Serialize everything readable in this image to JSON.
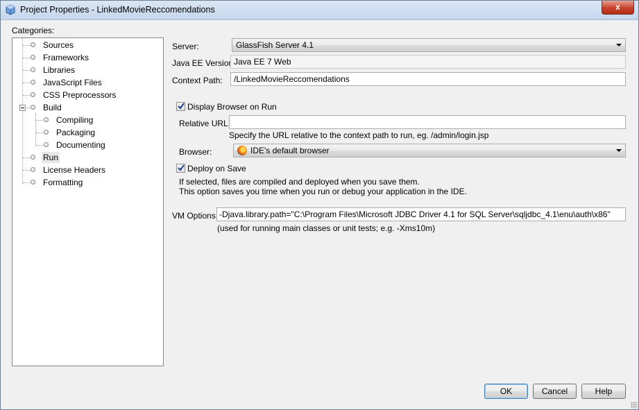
{
  "window": {
    "title": "Project Properties - LinkedMovieReccomendations",
    "close_label": "x"
  },
  "categories": {
    "label": "Categories:",
    "items": [
      {
        "label": "Sources"
      },
      {
        "label": "Frameworks"
      },
      {
        "label": "Libraries"
      },
      {
        "label": "JavaScript Files"
      },
      {
        "label": "CSS Preprocessors"
      },
      {
        "label": "Build",
        "expanded": true
      },
      {
        "label": "Compiling",
        "child_of": "Build"
      },
      {
        "label": "Packaging",
        "child_of": "Build"
      },
      {
        "label": "Documenting",
        "child_of": "Build"
      },
      {
        "label": "Run",
        "selected": true
      },
      {
        "label": "License Headers"
      },
      {
        "label": "Formatting"
      }
    ]
  },
  "run": {
    "server_label": "Server:",
    "server_value": "GlassFish Server 4.1",
    "javaee_label": "Java EE Version:",
    "javaee_value": "Java EE 7 Web",
    "context_label": "Context Path:",
    "context_value": "/LinkedMovieReccomendations",
    "display_browser_label": "Display Browser on Run",
    "display_browser_checked": true,
    "relative_url_label": "Relative URL:",
    "relative_url_value": "",
    "relative_url_hint": "Specify the URL relative to the context path to run, eg. /admin/login.jsp",
    "browser_label": "Browser:",
    "browser_value": "IDE's default browser",
    "browser_icon": "firefox-icon",
    "deploy_on_save_label": "Deploy on Save",
    "deploy_on_save_checked": true,
    "deploy_hint_1": "If selected, files are compiled and deployed when you save them.",
    "deploy_hint_2": "This option saves you time when you run or debug your application in the IDE.",
    "vm_options_label": "VM Options:",
    "vm_options_value": "-Djava.library.path=\"C:\\Program Files\\Microsoft JDBC Driver 4.1 for SQL Server\\sqljdbc_4.1\\enu\\auth\\x86\"",
    "vm_options_hint": "(used for running main classes or unit tests; e.g. -Xms10m)"
  },
  "buttons": {
    "ok": "OK",
    "cancel": "Cancel",
    "help": "Help"
  }
}
